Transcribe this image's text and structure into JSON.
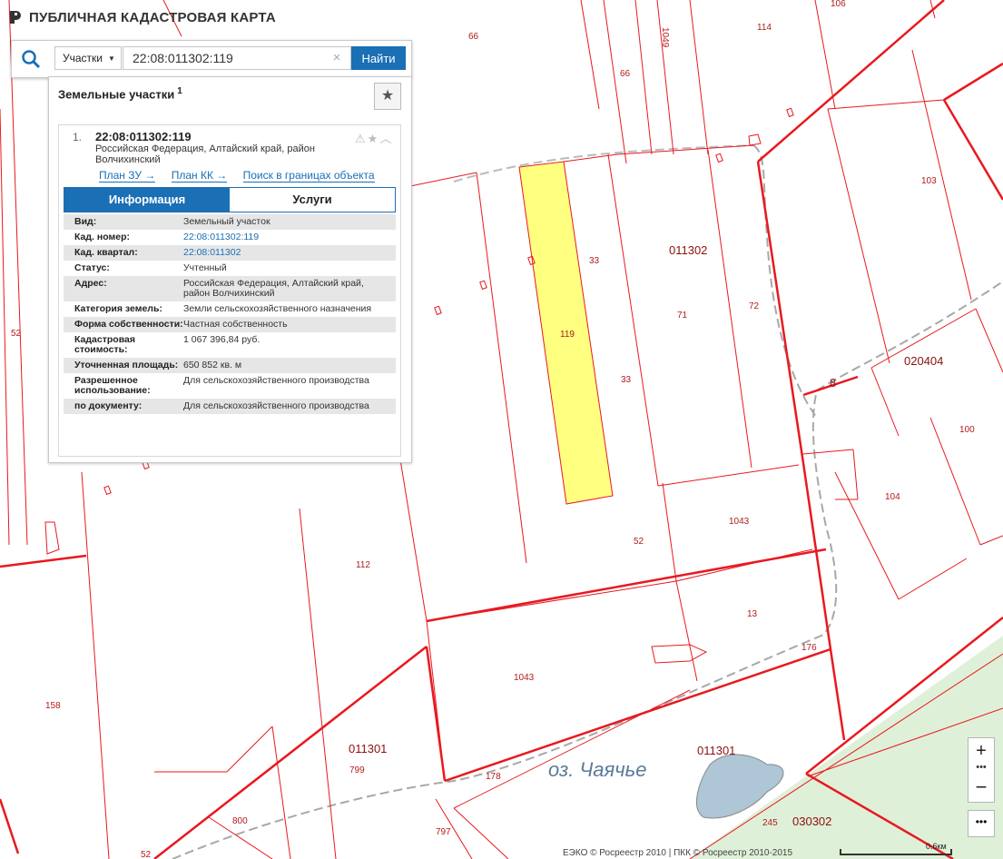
{
  "header": {
    "title": "ПУБЛИЧНАЯ КАДАСТРОВАЯ КАРТА"
  },
  "search": {
    "type_label": "Участки",
    "query": "22:08:011302:119",
    "find_label": "Найти"
  },
  "panel": {
    "title": "Земельные участки",
    "count": "1",
    "result": {
      "index": "1.",
      "number": "22:08:011302:119",
      "address": "Российская Федерация, Алтайский край, район Волчихинский",
      "links": [
        "План ЗУ →",
        "План КК →",
        "Поиск в границах объекта →"
      ],
      "tabs": [
        "Информация",
        "Услуги"
      ],
      "attributes": [
        {
          "key": "Вид:",
          "value": "Земельный участок"
        },
        {
          "key": "Кад. номер:",
          "value": "22:08:011302:119"
        },
        {
          "key": "Кад. квартал:",
          "value": "22:08:011302"
        },
        {
          "key": "Статус:",
          "value": "Учтенный"
        },
        {
          "key": "Адрес:",
          "value": "Российская Федерация, Алтайский край, район Волчихинский"
        },
        {
          "key": "Категория земель:",
          "value": "Земли сельскохозяйственного назначения"
        },
        {
          "key": "Форма собственности:",
          "value": "Частная собственность"
        },
        {
          "key": "Кадастровая стоимость:",
          "value": "1 067 396,84 руб."
        },
        {
          "key": "Уточненная площадь:",
          "value": "650 852 кв. м"
        },
        {
          "key": "Разрешенное использование:",
          "value": "Для сельскохозяйственного производства"
        },
        {
          "key": "по документу:",
          "value": "Для сельскохозяйственного производства"
        }
      ]
    }
  },
  "map": {
    "parcel_labels": [
      "66",
      "1049",
      "114",
      "106",
      "66",
      "103",
      "33",
      "011302",
      "72",
      "71",
      "119",
      "33",
      "8",
      "020404",
      "100",
      "104",
      "1043",
      "52",
      "112",
      "52",
      "13",
      "176",
      "1043",
      "158",
      "011301",
      "799",
      "178",
      "011301",
      "800",
      "797",
      "245",
      "030302",
      "52"
    ],
    "lake_label": "оз. Чаячье",
    "colors": {
      "boundary": "#e8191f",
      "highlight": "#ffff80",
      "water": "#aec6d6",
      "forest": "#dff0d8"
    }
  },
  "controls": {
    "zoom_in": "+",
    "zoom_out": "−",
    "more": "•••"
  },
  "footer": {
    "attribution": "ЕЭКО © Росреестр 2010 | ПКК © Росреестр 2010-2015",
    "scale": "0.6км"
  }
}
